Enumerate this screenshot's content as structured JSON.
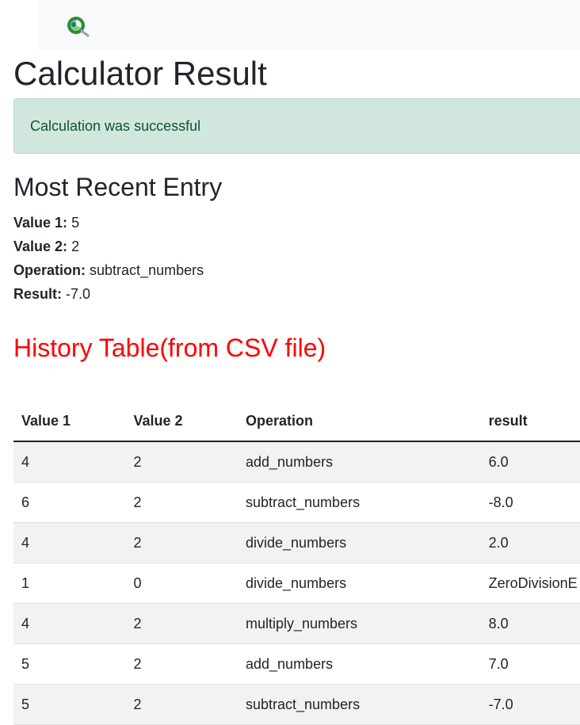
{
  "page": {
    "title": "Calculator Result",
    "alert": "Calculation was successful"
  },
  "recent": {
    "heading": "Most Recent Entry",
    "value1_label": "Value 1:",
    "value1": "5",
    "value2_label": "Value 2:",
    "value2": "2",
    "operation_label": "Operation:",
    "operation": "subtract_numbers",
    "result_label": "Result:",
    "result": "-7.0"
  },
  "history": {
    "heading": "History Table(from CSV file)",
    "columns": [
      "Value 1",
      "Value 2",
      "Operation",
      "result"
    ],
    "rows": [
      [
        "4",
        "2",
        "add_numbers",
        "6.0"
      ],
      [
        "6",
        "2",
        "subtract_numbers",
        "-8.0"
      ],
      [
        "4",
        "2",
        "divide_numbers",
        "2.0"
      ],
      [
        "1",
        "0",
        "divide_numbers",
        "ZeroDivisionE"
      ],
      [
        "4",
        "2",
        "multiply_numbers",
        "8.0"
      ],
      [
        "5",
        "2",
        "add_numbers",
        "7.0"
      ],
      [
        "5",
        "2",
        "subtract_numbers",
        "-7.0"
      ]
    ]
  },
  "icons": {
    "logo": "app-logo-icon"
  },
  "colors": {
    "alert_bg": "#d1e7dd",
    "alert_text": "#0f5132",
    "history_heading": "#ff0000",
    "stripe": "#f2f2f2"
  }
}
